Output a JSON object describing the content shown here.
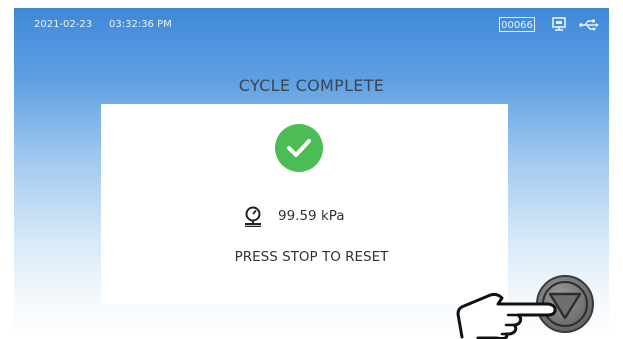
{
  "status_bar": {
    "date": "2021-02-23",
    "time": "03:32:36 PM",
    "counter": "00066",
    "icons": [
      "display-icon",
      "usb-icon"
    ]
  },
  "main": {
    "title": "CYCLE COMPLETE",
    "pressure_value": "99.59 kPa",
    "message": "PRESS STOP TO RESET"
  },
  "icons": {
    "success": "check-circle-icon",
    "gauge": "pressure-gauge-icon",
    "stop": "stop-button-icon",
    "hand": "pointing-hand-icon"
  },
  "colors": {
    "background_top": "#3f88d9",
    "success_green": "#4cbd55",
    "stop_button": "#6f6f6f"
  }
}
